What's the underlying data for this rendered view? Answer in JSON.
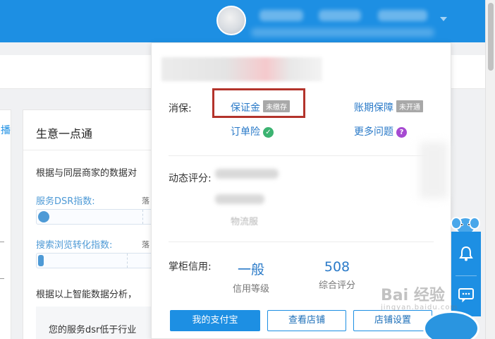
{
  "page": {
    "section_title": "生意一点通",
    "intro_text": "根据与同层商家的数据对",
    "service_dsr_label": "服务DSR指数:",
    "search_conversion_label": "搜索浏览转化指数:",
    "lag_label": "落",
    "analysis_text": "根据以上智能数据分析，",
    "tip_text": "您的服务dsr低于行业"
  },
  "panel": {
    "consumer_protection": {
      "label": "消保:",
      "deposit": {
        "text": "保证金",
        "badge": "未缴存"
      },
      "order_insurance": {
        "text": "订单险"
      },
      "account_guarantee": {
        "text": "账期保障",
        "badge": "未开通"
      },
      "more_questions": {
        "text": "更多问题"
      }
    },
    "dynamic_rating": {
      "label": "动态评分:",
      "logistics_hint": "物流服"
    },
    "credit": {
      "label": "掌柜信用:",
      "level_value": "一般",
      "level_caption": "信用等级",
      "score_value": "508",
      "score_caption": "综合评分"
    },
    "buttons": {
      "alipay": "我的支付宝",
      "view_shop": "查看店铺",
      "shop_settings": "店铺设置"
    }
  },
  "watermark": {
    "text": "Bai 经验",
    "sub": "jingyan.baidu.com"
  },
  "colors": {
    "brand_blue": "#1d8fe3",
    "link_blue": "#2a7ac8",
    "highlight_red": "#b3332b",
    "check_green": "#3cb371",
    "question_purple": "#a64ad1"
  },
  "icons": {
    "check": "check-circle-icon",
    "question": "question-circle-icon",
    "bell": "bell-icon",
    "chat": "chat-icon",
    "mascot": "elephant-mascot-icon"
  }
}
